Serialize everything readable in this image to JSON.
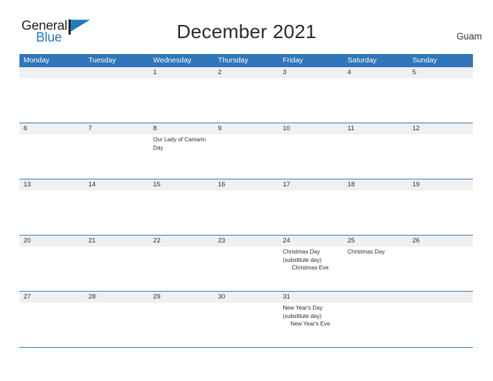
{
  "brand": {
    "name_part1": "General",
    "name_part2": "Blue",
    "flag_color": "#1f7ac0",
    "text_color": "#231f20"
  },
  "header": {
    "title": "December 2021",
    "location": "Guam"
  },
  "theme": {
    "header_blue": "#3076b8",
    "rule_blue": "#2e75b6",
    "date_strip_gray": "#f0f0f0",
    "text_dark": "#2b2b2b"
  },
  "calendar": {
    "weekday_headers": [
      "Monday",
      "Tuesday",
      "Wednesday",
      "Thursday",
      "Friday",
      "Saturday",
      "Sunday"
    ],
    "weeks": [
      {
        "days": [
          {
            "date": "",
            "events": []
          },
          {
            "date": "",
            "events": []
          },
          {
            "date": "1",
            "events": []
          },
          {
            "date": "2",
            "events": []
          },
          {
            "date": "3",
            "events": []
          },
          {
            "date": "4",
            "events": []
          },
          {
            "date": "5",
            "events": []
          }
        ]
      },
      {
        "days": [
          {
            "date": "6",
            "events": []
          },
          {
            "date": "7",
            "events": []
          },
          {
            "date": "8",
            "events": [
              {
                "text": "Our Lady of Camarin Day",
                "align": "left"
              }
            ]
          },
          {
            "date": "9",
            "events": []
          },
          {
            "date": "10",
            "events": []
          },
          {
            "date": "11",
            "events": []
          },
          {
            "date": "12",
            "events": []
          }
        ]
      },
      {
        "days": [
          {
            "date": "13",
            "events": []
          },
          {
            "date": "14",
            "events": []
          },
          {
            "date": "15",
            "events": []
          },
          {
            "date": "16",
            "events": []
          },
          {
            "date": "17",
            "events": []
          },
          {
            "date": "18",
            "events": []
          },
          {
            "date": "19",
            "events": []
          }
        ]
      },
      {
        "days": [
          {
            "date": "20",
            "events": []
          },
          {
            "date": "21",
            "events": []
          },
          {
            "date": "22",
            "events": []
          },
          {
            "date": "23",
            "events": []
          },
          {
            "date": "24",
            "events": [
              {
                "text": "Christmas Day (substitute day)",
                "align": "left"
              },
              {
                "text": "Christmas Eve",
                "align": "center"
              }
            ]
          },
          {
            "date": "25",
            "events": [
              {
                "text": "Christmas Day",
                "align": "left"
              }
            ]
          },
          {
            "date": "26",
            "events": []
          }
        ]
      },
      {
        "days": [
          {
            "date": "27",
            "events": []
          },
          {
            "date": "28",
            "events": []
          },
          {
            "date": "29",
            "events": []
          },
          {
            "date": "30",
            "events": []
          },
          {
            "date": "31",
            "events": [
              {
                "text": "New Year's Day (substitute day)",
                "align": "left"
              },
              {
                "text": "New Year's Eve",
                "align": "center"
              }
            ]
          },
          {
            "date": "",
            "events": []
          },
          {
            "date": "",
            "events": []
          }
        ]
      }
    ]
  }
}
